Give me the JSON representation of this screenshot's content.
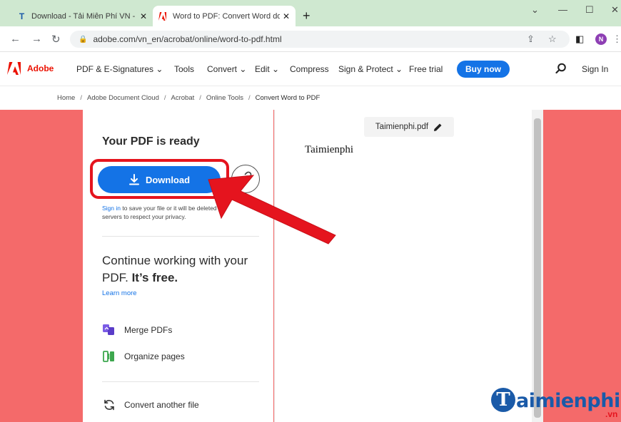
{
  "browser": {
    "tabs": [
      {
        "title": "Download - Tải Miễn Phí VN - Ph",
        "active": false
      },
      {
        "title": "Word to PDF: Convert Word doc",
        "active": true
      }
    ],
    "new_tab": "+",
    "url": "adobe.com/vn_en/acrobat/online/word-to-pdf.html",
    "profile_initial": "N"
  },
  "adobe_nav": {
    "brand": "Adobe",
    "items": [
      "PDF & E-Signatures ⌄",
      "Tools",
      "Convert ⌄",
      "Edit ⌄",
      "Compress",
      "Sign & Protect ⌄",
      "Free trial"
    ],
    "buy_now": "Buy now",
    "sign_in": "Sign In"
  },
  "breadcrumb": [
    "Home",
    "Adobe Document Cloud",
    "Acrobat",
    "Online Tools",
    "Convert Word to PDF"
  ],
  "panel": {
    "ready_title": "Your PDF is ready",
    "download_label": "Download",
    "signin_link": "Sign in",
    "signin_rest": " to save your file or it will be deleted fr servers to respect your privacy.",
    "continue_plain": "Continue working with your PDF.",
    "continue_bold": "It’s free.",
    "learn_more": "Learn more",
    "tools": [
      {
        "label": "Merge PDFs",
        "icon": "merge-pdfs-icon"
      },
      {
        "label": "Organize pages",
        "icon": "organize-pages-icon"
      },
      {
        "label": "Convert another file",
        "icon": "refresh-icon"
      }
    ]
  },
  "preview": {
    "filename": "Taimienphi.pdf",
    "document_text": "Taimienphi"
  },
  "watermark": {
    "brand": "aimienphi",
    "suffix": ".vn"
  },
  "colors": {
    "accent": "#1473e6",
    "adobe_red": "#eb1000",
    "background": "#f46a6a",
    "highlight": "#e5141e"
  }
}
